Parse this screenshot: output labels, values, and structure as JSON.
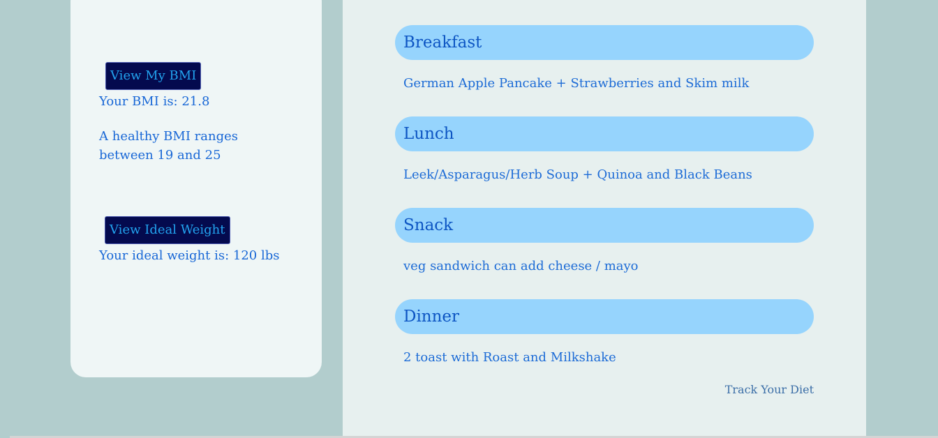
{
  "sidebar": {
    "bmi_button_label": "View My BMI",
    "bmi_result": "Your BMI is: 21.8",
    "bmi_note": "A healthy BMI ranges between 19 and 25",
    "weight_button_label": "View Ideal Weight",
    "weight_result": "Your ideal weight is: 120 lbs"
  },
  "meals": [
    {
      "title": "Breakfast",
      "description": "German Apple Pancake + Strawberries and Skim milk"
    },
    {
      "title": "Lunch",
      "description": "Leek/Asparagus/Herb Soup + Quinoa and Black Beans"
    },
    {
      "title": "Snack",
      "description": "veg sandwich can add cheese / mayo"
    },
    {
      "title": "Dinner",
      "description": "2 toast with Roast and Milkshake"
    }
  ],
  "track_link": "Track Your Diet",
  "colors": {
    "page_bg": "#b2cdcd",
    "card_bg": "#eff6f6",
    "panel_bg": "#e7f0ef",
    "meal_header_bg": "#96d4fd",
    "button_bg": "#040a4e",
    "button_text": "#22a3ef",
    "text": "#1867d6"
  }
}
